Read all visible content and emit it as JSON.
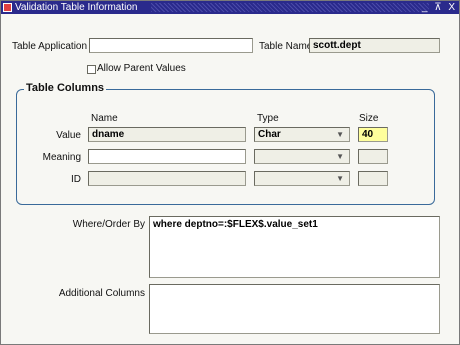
{
  "window": {
    "title": "Validation Table Information",
    "controls": "_ ⊼ X"
  },
  "table_application": {
    "label": "Table Application",
    "value": ""
  },
  "table_name": {
    "label": "Table Name",
    "value": "scott.dept"
  },
  "allow_parent": {
    "label": "Allow Parent Values",
    "checked": false
  },
  "table_columns": {
    "title": "Table Columns",
    "headers": {
      "name": "Name",
      "type": "Type",
      "size": "Size"
    },
    "rows": [
      {
        "label": "Value",
        "name": "dname",
        "type": "Char",
        "size": "40"
      },
      {
        "label": "Meaning",
        "name": "",
        "type": "",
        "size": ""
      },
      {
        "label": "ID",
        "name": "",
        "type": "",
        "size": ""
      }
    ]
  },
  "where_order_by": {
    "label": "Where/Order By",
    "value": "where deptno=:$FLEX$.value_set1"
  },
  "additional_columns": {
    "label": "Additional Columns",
    "value": ""
  }
}
